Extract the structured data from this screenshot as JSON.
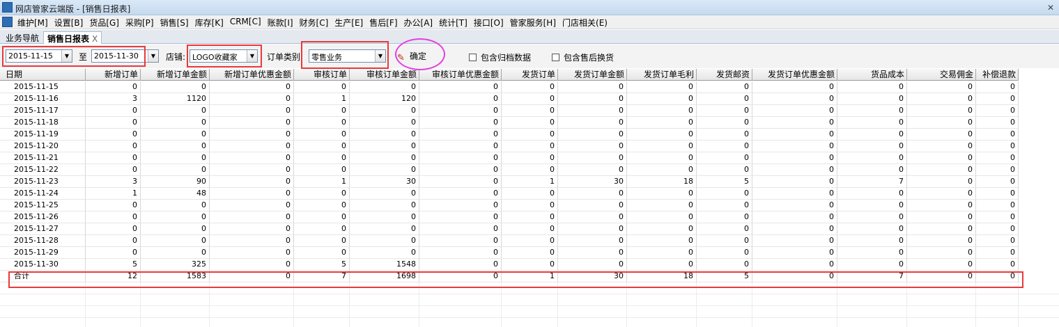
{
  "window": {
    "title": "网店管家云端版 - [销售日报表]"
  },
  "menu": [
    "维护[M]",
    "设置[B]",
    "货品[G]",
    "采购[P]",
    "销售[S]",
    "库存[K]",
    "CRM[C]",
    "账款[I]",
    "财务[C]",
    "生产[E]",
    "售后[F]",
    "办公[A]",
    "统计[T]",
    "接口[O]",
    "管家服务[H]",
    "门店相关(E)"
  ],
  "tabs": {
    "nav": "业务导航",
    "active": "销售日报表",
    "close": "X"
  },
  "toolbar": {
    "date_from": "2015-11-15",
    "to_label": "至",
    "date_to": "2015-11-30",
    "store_label": "店铺:",
    "store_value": "LOGO收藏家",
    "order_type_label": "订单类别:",
    "order_type_value": "零售业务",
    "confirm_label": "确定",
    "check_archive": "包含归档数据",
    "check_aftersale": "包含售后换货"
  },
  "table": {
    "columns": [
      "日期",
      "新增订单",
      "新增订单金额",
      "新增订单优惠金额",
      "审核订单",
      "审核订单金额",
      "审核订单优惠金额",
      "发货订单",
      "发货订单金额",
      "发货订单毛利",
      "发货邮资",
      "发货订单优惠金额",
      "货品成本",
      "交易佣金",
      "补偿退款"
    ],
    "rows": [
      [
        "2015-11-15",
        "0",
        "0",
        "0",
        "0",
        "0",
        "0",
        "0",
        "0",
        "0",
        "0",
        "0",
        "0",
        "0",
        "0"
      ],
      [
        "2015-11-16",
        "3",
        "1120",
        "0",
        "1",
        "120",
        "0",
        "0",
        "0",
        "0",
        "0",
        "0",
        "0",
        "0",
        "0"
      ],
      [
        "2015-11-17",
        "0",
        "0",
        "0",
        "0",
        "0",
        "0",
        "0",
        "0",
        "0",
        "0",
        "0",
        "0",
        "0",
        "0"
      ],
      [
        "2015-11-18",
        "0",
        "0",
        "0",
        "0",
        "0",
        "0",
        "0",
        "0",
        "0",
        "0",
        "0",
        "0",
        "0",
        "0"
      ],
      [
        "2015-11-19",
        "0",
        "0",
        "0",
        "0",
        "0",
        "0",
        "0",
        "0",
        "0",
        "0",
        "0",
        "0",
        "0",
        "0"
      ],
      [
        "2015-11-20",
        "0",
        "0",
        "0",
        "0",
        "0",
        "0",
        "0",
        "0",
        "0",
        "0",
        "0",
        "0",
        "0",
        "0"
      ],
      [
        "2015-11-21",
        "0",
        "0",
        "0",
        "0",
        "0",
        "0",
        "0",
        "0",
        "0",
        "0",
        "0",
        "0",
        "0",
        "0"
      ],
      [
        "2015-11-22",
        "0",
        "0",
        "0",
        "0",
        "0",
        "0",
        "0",
        "0",
        "0",
        "0",
        "0",
        "0",
        "0",
        "0"
      ],
      [
        "2015-11-23",
        "3",
        "90",
        "0",
        "1",
        "30",
        "0",
        "1",
        "30",
        "18",
        "5",
        "0",
        "7",
        "0",
        "0"
      ],
      [
        "2015-11-24",
        "1",
        "48",
        "0",
        "0",
        "0",
        "0",
        "0",
        "0",
        "0",
        "0",
        "0",
        "0",
        "0",
        "0"
      ],
      [
        "2015-11-25",
        "0",
        "0",
        "0",
        "0",
        "0",
        "0",
        "0",
        "0",
        "0",
        "0",
        "0",
        "0",
        "0",
        "0"
      ],
      [
        "2015-11-26",
        "0",
        "0",
        "0",
        "0",
        "0",
        "0",
        "0",
        "0",
        "0",
        "0",
        "0",
        "0",
        "0",
        "0"
      ],
      [
        "2015-11-27",
        "0",
        "0",
        "0",
        "0",
        "0",
        "0",
        "0",
        "0",
        "0",
        "0",
        "0",
        "0",
        "0",
        "0"
      ],
      [
        "2015-11-28",
        "0",
        "0",
        "0",
        "0",
        "0",
        "0",
        "0",
        "0",
        "0",
        "0",
        "0",
        "0",
        "0",
        "0"
      ],
      [
        "2015-11-29",
        "0",
        "0",
        "0",
        "0",
        "0",
        "0",
        "0",
        "0",
        "0",
        "0",
        "0",
        "0",
        "0",
        "0"
      ],
      [
        "2015-11-30",
        "5",
        "325",
        "0",
        "5",
        "1548",
        "0",
        "0",
        "0",
        "0",
        "0",
        "0",
        "0",
        "0",
        "0"
      ]
    ],
    "total": [
      "合计",
      "12",
      "1583",
      "0",
      "7",
      "1698",
      "0",
      "1",
      "30",
      "18",
      "5",
      "0",
      "7",
      "0",
      "0"
    ]
  },
  "colors": {
    "highlight_box": "#e8393c",
    "highlight_circle": "#e43ee4"
  }
}
